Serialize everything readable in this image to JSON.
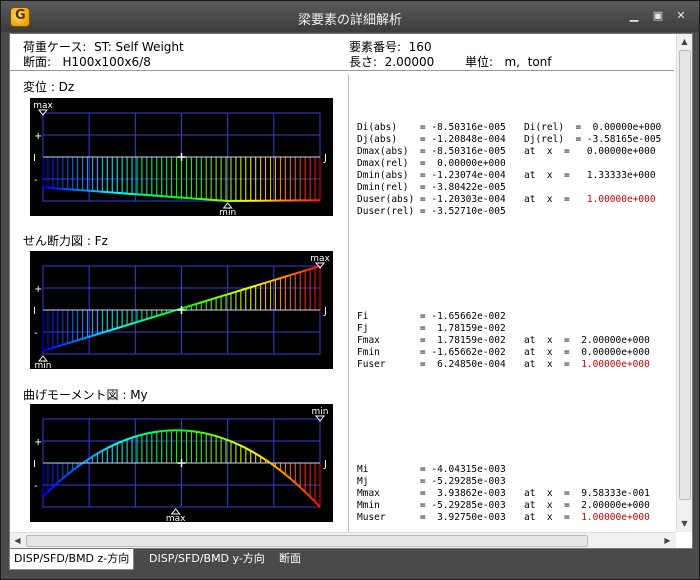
{
  "window": {
    "title": "梁要素の詳細解析"
  },
  "header": {
    "load_case": "荷重ケース:  ST: Self Weight",
    "section": "断面:   H100x100x6/8",
    "element_no": "要素番号:  160",
    "length": "長さ:  2.00000",
    "unit": "単位:   m,  tonf"
  },
  "sections": {
    "disp": "変位 : Dz",
    "shear": "せん断力図 : Fz",
    "moment": "曲げモーメント図 : My"
  },
  "plot_labels": {
    "plus": "+",
    "minus": "-",
    "i": "I",
    "j": "J",
    "max": "max",
    "min": "min"
  },
  "results": {
    "disp": [
      {
        "l": "Di(abs)",
        "v": "= -8.50316e-005",
        "r": "Di(rel)  =  0.00000e+000"
      },
      {
        "l": "Dj(abs)",
        "v": "= -1.20848e-004",
        "r": "Dj(rel)  = -3.58165e-005"
      },
      {
        "l": "Dmax(abs)",
        "v": "= -8.50316e-005",
        "r": "at  x  =   0.00000e+000"
      },
      {
        "l": "Dmax(rel)",
        "v": "=  0.00000e+000",
        "r": ""
      },
      {
        "l": "Dmin(abs)",
        "v": "= -1.23074e-004",
        "r": "at  x  =   1.33333e+000"
      },
      {
        "l": "Dmin(rel)",
        "v": "= -3.80422e-005",
        "r": ""
      },
      {
        "l": "Duser(abs)",
        "v": "= -1.20303e-004",
        "r": "at  x  =   ",
        "red": "1.00000e+000"
      },
      {
        "l": "Duser(rel)",
        "v": "= -3.52710e-005",
        "r": ""
      }
    ],
    "shear": [
      {
        "l": "Fi",
        "v": "= -1.65662e-002",
        "r": ""
      },
      {
        "l": "Fj",
        "v": "=  1.78159e-002",
        "r": ""
      },
      {
        "l": "Fmax",
        "v": "=  1.78159e-002",
        "r": "at  x  =  2.00000e+000"
      },
      {
        "l": "Fmin",
        "v": "= -1.65662e-002",
        "r": "at  x  =  0.00000e+000"
      },
      {
        "l": "Fuser",
        "v": "=  6.24850e-004",
        "r": "at  x  =  ",
        "red": "1.00000e+000"
      }
    ],
    "moment": [
      {
        "l": "Mi",
        "v": "= -4.04315e-003",
        "r": ""
      },
      {
        "l": "Mj",
        "v": "= -5.29285e-003",
        "r": ""
      },
      {
        "l": "Mmax",
        "v": "=  3.93862e-003",
        "r": "at  x  =  9.58333e-001"
      },
      {
        "l": "Mmin",
        "v": "= -5.29285e-003",
        "r": "at  x  =  2.00000e+000"
      },
      {
        "l": "Muser",
        "v": "=  3.92750e-003",
        "r": "at  x  =  ",
        "red": "1.00000e+000"
      }
    ]
  },
  "tabs": [
    "DISP/SFD/BMD z-方向",
    "DISP/SFD/BMD y-方向",
    "断面"
  ],
  "chart_data": [
    {
      "type": "area",
      "series": [
        {
          "name": "Dz",
          "x": [
            0,
            1.33333,
            2.0
          ],
          "values": [
            -8.50316e-05,
            -0.000123074,
            -0.000120848
          ]
        }
      ]
    },
    {
      "type": "area",
      "series": [
        {
          "name": "Fz",
          "x": [
            0,
            2.0
          ],
          "values": [
            -0.0165662,
            0.0178159
          ]
        }
      ]
    },
    {
      "type": "area",
      "series": [
        {
          "name": "My",
          "x": [
            0,
            0.958333,
            2.0
          ],
          "values": [
            -0.00404315,
            0.00393862,
            -0.00529285
          ]
        }
      ]
    }
  ]
}
